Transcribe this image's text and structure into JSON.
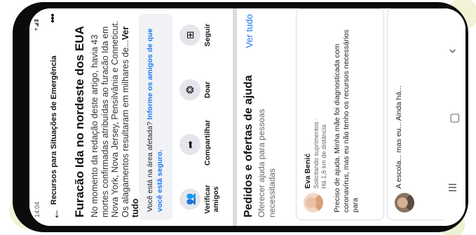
{
  "status": {
    "time": "14:04",
    "icons": "▾◢▮"
  },
  "topbar": {
    "title": "Recursos para Situações de Emergência"
  },
  "article": {
    "title": "Furacão Ida no nordeste dos EUA",
    "body": "No momento da redação deste artigo, havia 43 mortes confirmadas atribuídas ao furacão Ida em Nova York, Nova Jersey, Pensilvânia e Conneticut. Os alagamentos resultaram em milhares de...",
    "more": "Ver tudo"
  },
  "prompt": {
    "text": "Você está na área afetada? ",
    "link": "Informe os amigos de que você está seguro."
  },
  "actions": [
    {
      "icon": "people-icon",
      "glyph": "👥",
      "label": "Verificar amigos"
    },
    {
      "icon": "share-icon",
      "glyph": "➦",
      "label": "Compartilhar"
    },
    {
      "icon": "donate-icon",
      "glyph": "❂",
      "label": "Doar"
    },
    {
      "icon": "follow-icon",
      "glyph": "⊞",
      "label": "Seguir"
    }
  ],
  "help": {
    "title": "Pedidos e ofertas de ajuda",
    "subtitle": "Oferecer ajuda para pessoas necessitadas",
    "see_all": "Ver tudo",
    "card": {
      "name": "Eva Benić",
      "line1": "Solicitando suprimentos ·",
      "line2": "Há 1,6 km de distância",
      "text": "Preciso de ajuda. Minha mãe foi diagnosticada com coronavírus, mas eu não tenho os recursos necessários para"
    },
    "card2": {
      "text": "A escola... mas eu... Ainda há..."
    }
  },
  "nav": {
    "menu": "III",
    "home": "▢",
    "back": "‹"
  }
}
